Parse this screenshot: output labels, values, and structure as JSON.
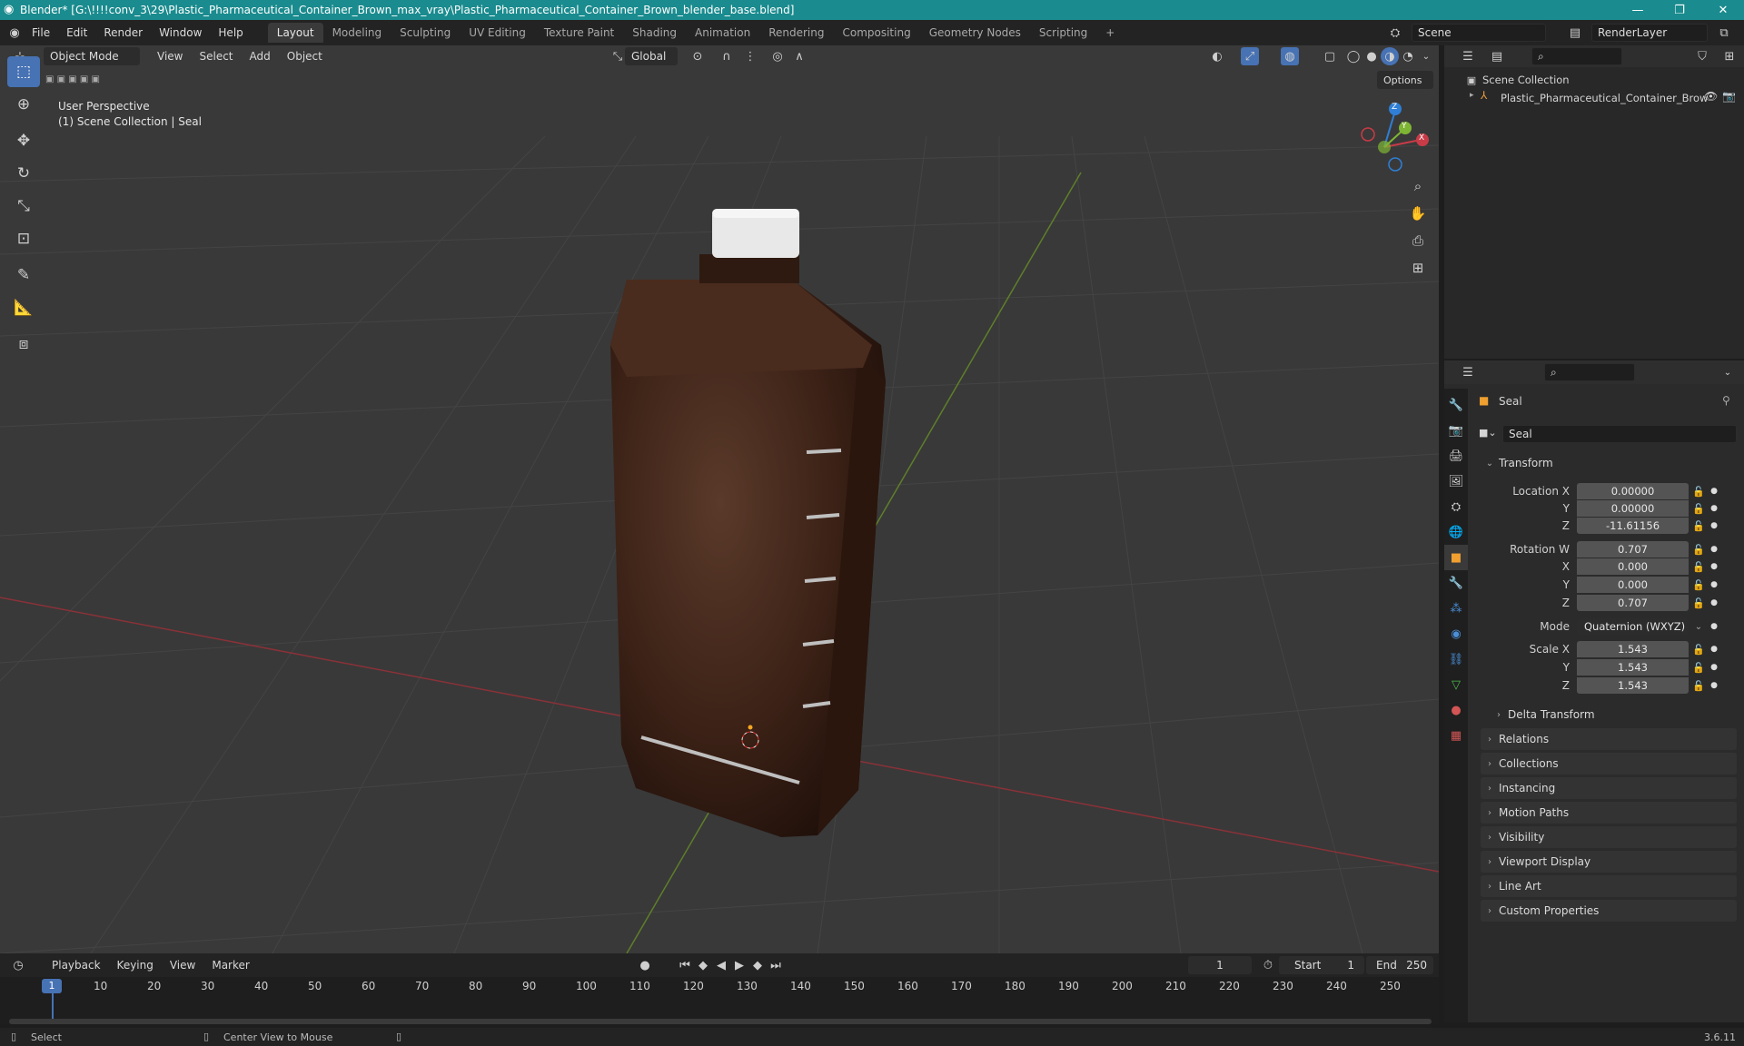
{
  "window": {
    "title": "Blender* [G:\\!!!!conv_3\\29\\Plastic_Pharmaceutical_Container_Brown_max_vray\\Plastic_Pharmaceutical_Container_Brown_blender_base.blend]",
    "minimize": "—",
    "maximize": "❐",
    "close": "✕"
  },
  "menu": {
    "items": [
      "File",
      "Edit",
      "Render",
      "Window",
      "Help"
    ],
    "workspaces": [
      "Layout",
      "Modeling",
      "Sculpting",
      "UV Editing",
      "Texture Paint",
      "Shading",
      "Animation",
      "Rendering",
      "Compositing",
      "Geometry Nodes",
      "Scripting"
    ],
    "active_workspace": "Layout",
    "add_workspace": "+",
    "scene_label": "Scene",
    "layer_label": "RenderLayer"
  },
  "viewport": {
    "mode": "Object Mode",
    "menus": [
      "View",
      "Select",
      "Add",
      "Object"
    ],
    "orientation": "Global",
    "options_label": "Options",
    "overlay_line1": "User Perspective",
    "overlay_line2": "(1) Scene Collection | Seal",
    "gizmo_axes": {
      "x": "X",
      "y": "Y",
      "z": "Z"
    },
    "colors": {
      "x_axis": "#c93b47",
      "y_axis": "#7fb534",
      "z_axis": "#2f7fd6",
      "bg": "#393939",
      "bottle": "#3b2116"
    }
  },
  "outliner": {
    "root": "Scene Collection",
    "items": [
      {
        "label": "Plastic_Pharmaceutical_Container_Brow"
      }
    ]
  },
  "properties": {
    "object_name": "Seal",
    "data_name": "Seal",
    "transform_header": "Transform",
    "location": {
      "label": "Location X",
      "x": "0.00000",
      "y": "0.00000",
      "z": "-11.61156"
    },
    "rotation": {
      "label": "Rotation W",
      "w": "0.707",
      "x": "0.000",
      "y": "0.000",
      "z": "0.707"
    },
    "mode_label": "Mode",
    "mode_value": "Quaternion (WXYZ)",
    "scale": {
      "label": "Scale X",
      "x": "1.543",
      "y": "1.543",
      "z": "1.543"
    },
    "axis_y": "Y",
    "axis_z": "Z",
    "axis_x": "X",
    "delta": "Delta Transform",
    "panels": [
      "Relations",
      "Collections",
      "Instancing",
      "Motion Paths",
      "Visibility",
      "Viewport Display",
      "Line Art",
      "Custom Properties"
    ]
  },
  "timeline": {
    "menus": [
      "Playback",
      "Keying",
      "View",
      "Marker"
    ],
    "current_frame": "1",
    "start_label": "Start",
    "start": "1",
    "end_label": "End",
    "end": "250",
    "ticks": [
      "1",
      "10",
      "20",
      "30",
      "40",
      "50",
      "60",
      "70",
      "80",
      "90",
      "100",
      "110",
      "120",
      "130",
      "140",
      "150",
      "160",
      "170",
      "180",
      "190",
      "200",
      "210",
      "220",
      "230",
      "240",
      "250"
    ]
  },
  "status": {
    "left": "Select",
    "middle": "Center View to Mouse",
    "version": "3.6.11"
  }
}
